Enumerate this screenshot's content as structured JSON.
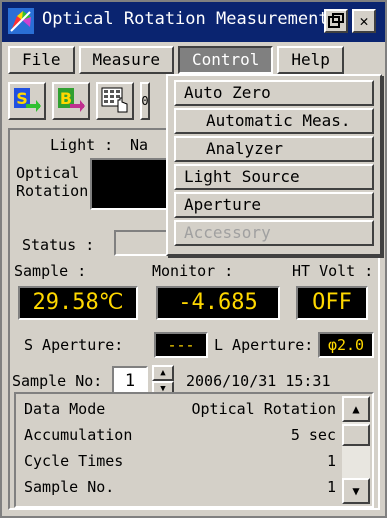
{
  "window": {
    "title": "Optical Rotation Measurement"
  },
  "menu": [
    "File",
    "Measure",
    "Control",
    "Help"
  ],
  "toolbar": {
    "buttons": [
      {
        "name": "s-button",
        "glyph": "S"
      },
      {
        "name": "b-button",
        "glyph": "B"
      },
      {
        "name": "keypad-button",
        "glyph": ""
      },
      {
        "name": "zero-button",
        "glyph": "0"
      }
    ]
  },
  "panel": {
    "light_label": "Light :",
    "light_value": "Na",
    "optical_label_1": "Optical",
    "optical_label_2": "Rotation:",
    "status_label": "Status :",
    "sample_label": "Sample :",
    "monitor_label": "Monitor :",
    "ht_volt_label": "HT Volt :",
    "sample_value": "29.58℃",
    "monitor_value": "-4.685",
    "ht_volt_value": "OFF",
    "s_aperture_label": "S Aperture:",
    "s_aperture_value": "---",
    "l_aperture_label": "L Aperture:",
    "l_aperture_value": "φ2.0",
    "sample_no_label": "Sample No:",
    "sample_no_value": "1",
    "datetime": "2006/10/31 15:31"
  },
  "datalist": [
    {
      "key": "Data Mode",
      "value": "Optical Rotation"
    },
    {
      "key": "Accumulation",
      "value": "5 sec"
    },
    {
      "key": "Cycle Times",
      "value": "1"
    },
    {
      "key": "Sample No.",
      "value": "1"
    }
  ],
  "dropdown": {
    "auto_zero": "Auto Zero",
    "automatic_meas": "Automatic Meas.",
    "analyzer": "Analyzer",
    "light_source": "Light Source",
    "aperture": "Aperture",
    "accessory": "Accessory"
  },
  "colors": {
    "title_bar": "#0a2470",
    "lcd_bg": "#000000",
    "lcd_fg": "#ffd800",
    "face": "#d4d0c8"
  }
}
